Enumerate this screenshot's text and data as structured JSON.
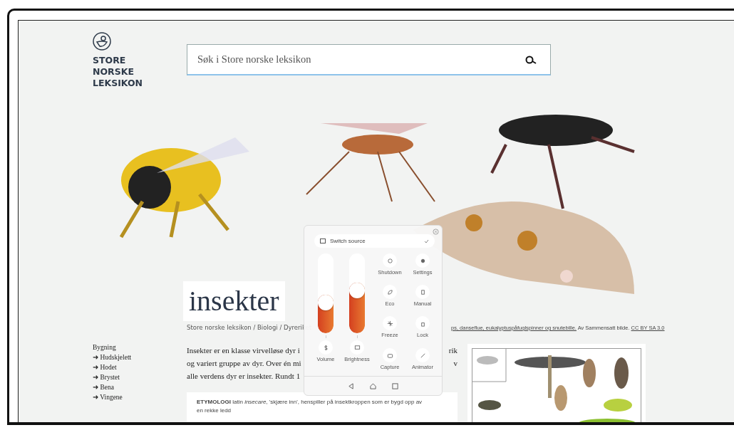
{
  "logo": {
    "lines": [
      "STORE",
      "NORSKE",
      "LEKSIKON"
    ]
  },
  "search": {
    "placeholder": "Søk i Store norske leksikon"
  },
  "title": "insekter",
  "caption": {
    "text": "ps, danseflue, eukalyptuspåfuglspinner og snutebille.",
    "credit": "Av Sammensatt bilde.",
    "license": "CC BY SA 3.0"
  },
  "breadcrumb": "Store norske leksikon / Biologi / Dyreriket",
  "sidebar": {
    "heading": "Bygning",
    "items": [
      {
        "arrow": "➜",
        "label": "Hudskjelett"
      },
      {
        "arrow": "➜",
        "label": "Hodet"
      },
      {
        "arrow": "➜",
        "label": "Brystet"
      },
      {
        "arrow": "➜",
        "label": "Bena"
      },
      {
        "arrow": "➜",
        "label": "Vingene"
      }
    ]
  },
  "paragraph": [
    {
      "left": "Insekter er en klasse virvelløse dyr i",
      "right": "rik"
    },
    {
      "left": "og variert gruppe av dyr. Over én mi",
      "right": "v"
    },
    {
      "left": "alle verdens dyr er insekter. Rundt 1"
    }
  ],
  "etymology": {
    "line1": "**ETYMOLOGI** latin *insecare*, 'skjære inn', henspiller på insektkroppen som er bygd opp av",
    "line2": "en rekke ledd"
  },
  "panel": {
    "source": "Switch source",
    "sliders": [
      {
        "label": "Volume",
        "level": 0.48
      },
      {
        "label": "Brightness",
        "level": 0.63
      }
    ],
    "tiles": [
      {
        "label": "Shutdown"
      },
      {
        "label": "Settings"
      },
      {
        "label": "Eco"
      },
      {
        "label": "Manual"
      },
      {
        "label": "Freeze"
      },
      {
        "label": "Lock"
      },
      {
        "label": "Capture"
      },
      {
        "label": "Animator"
      }
    ]
  }
}
